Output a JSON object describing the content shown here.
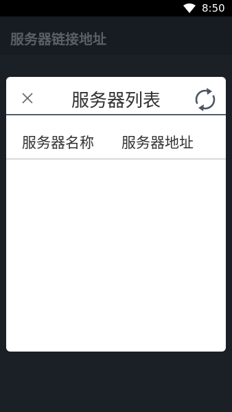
{
  "status_bar": {
    "time": "8:50",
    "icons": [
      "wifi-icon"
    ]
  },
  "app": {
    "title": "服务器链接地址"
  },
  "dialog": {
    "title": "服务器列表",
    "close_icon": "close-icon",
    "refresh_icon": "refresh-icon",
    "columns": [
      "服务器名称",
      "服务器地址"
    ],
    "rows": []
  },
  "colors": {
    "background": "#1b1f26",
    "header_background": "#171b22",
    "status_bar": "#000000",
    "dialog_background": "#ffffff",
    "divider": "#545c6a",
    "icon": "#4a5564"
  }
}
